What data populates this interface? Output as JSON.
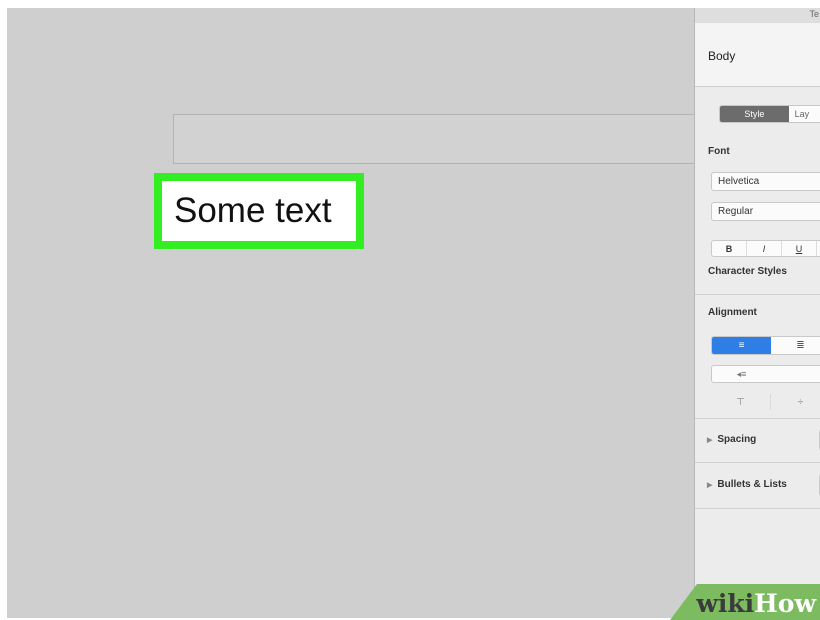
{
  "canvas": {
    "text_box_text": "Some text"
  },
  "inspector": {
    "top_label": "Te",
    "paragraph_style": "Body",
    "tabs": [
      {
        "label": "Style",
        "active": true
      },
      {
        "label": "Lay",
        "active": false
      }
    ],
    "font_section": {
      "label": "Font",
      "font_family": "Helvetica",
      "typeface": "Regular",
      "buttons": {
        "bold": "B",
        "italic": "I",
        "underline": "U"
      }
    },
    "character_styles_label": "Character Styles",
    "alignment": {
      "label": "Alignment",
      "align_left_glyph": "≡",
      "align_center_glyph": "≣",
      "indent_glyph": "◂≡",
      "valign_top_glyph": "⊤",
      "valign_middle_glyph": "÷"
    },
    "spacing_label": "Spacing",
    "bullets_label": "Bullets & Lists"
  },
  "watermark": {
    "part1": "wiki",
    "part2": "How"
  },
  "colors": {
    "selection_border": "#33ee22",
    "accent_blue": "#2f7ee5",
    "canvas_bg": "#cfcfcf"
  }
}
